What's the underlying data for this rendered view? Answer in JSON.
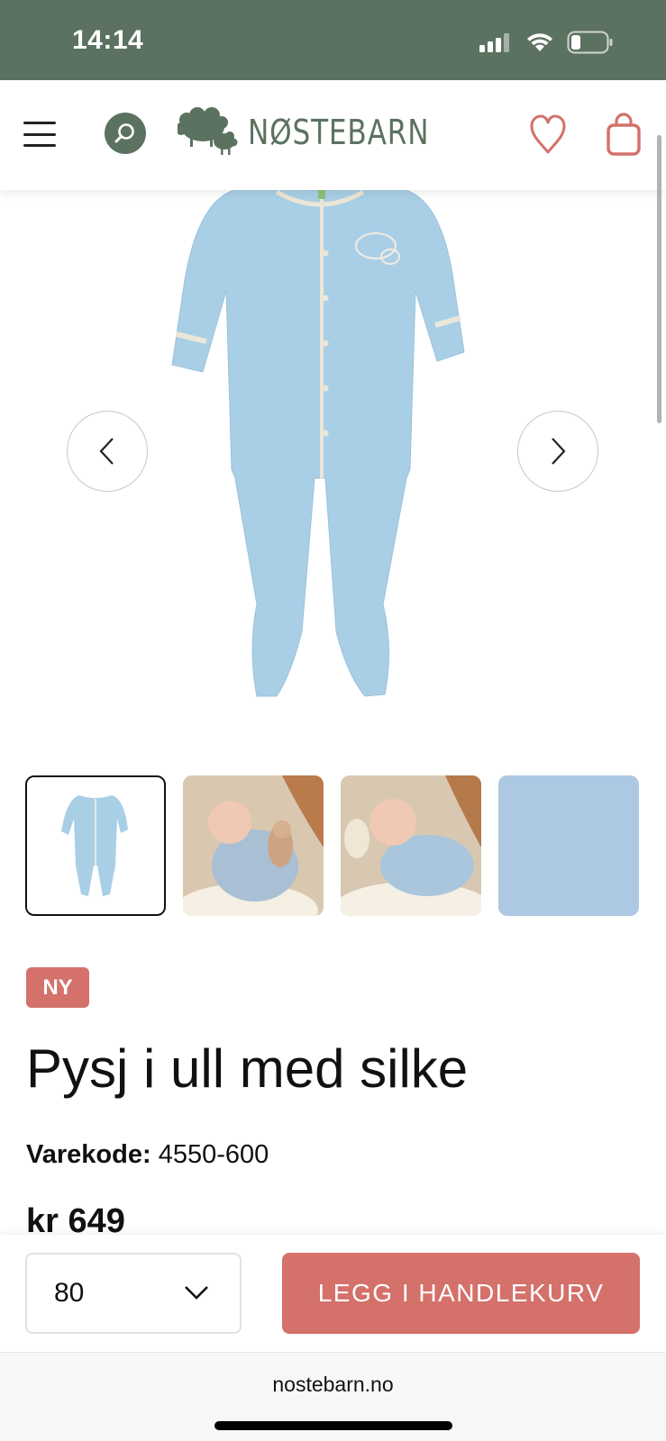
{
  "status_bar": {
    "time": "14:14",
    "icons": [
      "signal-icon",
      "wifi-icon",
      "battery-icon"
    ],
    "background": "#5c7261"
  },
  "header": {
    "logo_text": "NØSTEBARN",
    "menu_icon": "hamburger-menu-icon",
    "search_icon": "search-icon",
    "wishlist_icon": "heart-icon",
    "cart_icon": "shopping-bag-icon",
    "brand_color": "#5c7261",
    "accent_color": "#d4716a"
  },
  "gallery": {
    "prev_icon": "chevron-left-icon",
    "next_icon": "chevron-right-icon",
    "main_image": "light-blue-wool-romper",
    "thumbnails": [
      {
        "image": "romper-front",
        "active": true
      },
      {
        "image": "baby-with-bunny",
        "active": false
      },
      {
        "image": "baby-lying",
        "active": false
      },
      {
        "image": "fabric-closeup",
        "active": false
      }
    ]
  },
  "product": {
    "badge": "NY",
    "title": "Pysj i ull med silke",
    "sku_label": "Varekode:",
    "sku_value": "4550-600",
    "price": "kr 649"
  },
  "buy_bar": {
    "size_selected": "80",
    "size_chevron_icon": "chevron-down-icon",
    "add_to_cart_label": "LEGG I HANDLEKURV"
  },
  "browser": {
    "url": "nostebarn.no"
  }
}
